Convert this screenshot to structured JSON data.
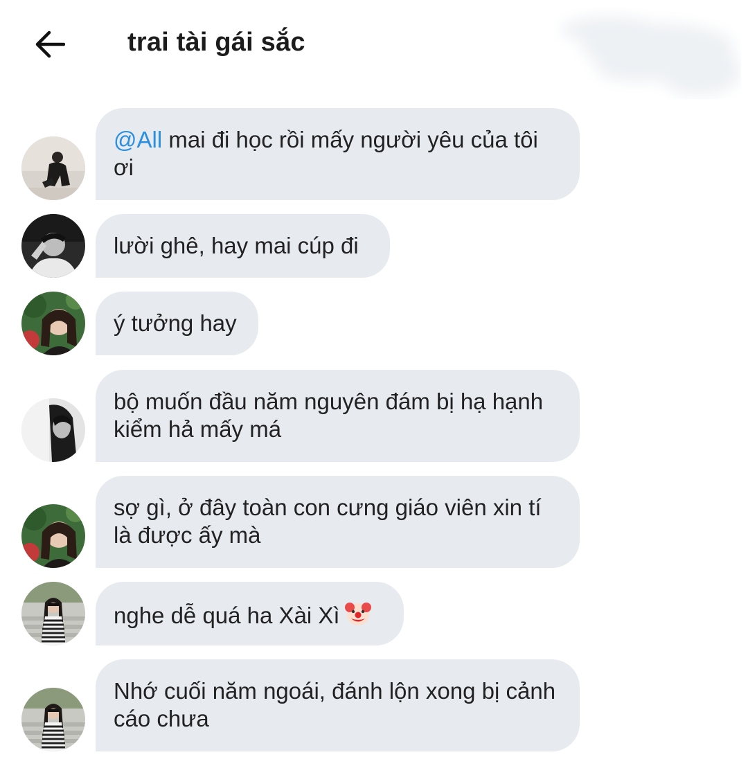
{
  "header": {
    "title": "trai tài gái sắc",
    "back_icon": "arrow-left-icon"
  },
  "messages": [
    {
      "mention": "@All",
      "text": " mai đi học rồi mấy người yêu của tôi ơi",
      "avatar": "avatar-1"
    },
    {
      "text": "lười ghê, hay mai cúp đi",
      "avatar": "avatar-2"
    },
    {
      "text": "ý tưởng hay",
      "avatar": "avatar-3"
    },
    {
      "text": "bộ muốn đầu năm nguyên đám bị hạ hạnh kiểm hả mấy má",
      "avatar": "avatar-4"
    },
    {
      "text": "sợ gì, ở đây toàn con cưng giáo viên xin tí là được ấy mà",
      "avatar": "avatar-3"
    },
    {
      "text": "nghe dễ quá ha Xài Xì",
      "emoji": "clown-face-emoji",
      "avatar": "avatar-5"
    },
    {
      "text": "Nhớ cuối năm ngoái, đánh lộn xong bị cảnh cáo chưa",
      "avatar": "avatar-5"
    }
  ],
  "colors": {
    "bubble": "#e7ebf0",
    "mention": "#2a8fe0",
    "text": "#222222"
  }
}
